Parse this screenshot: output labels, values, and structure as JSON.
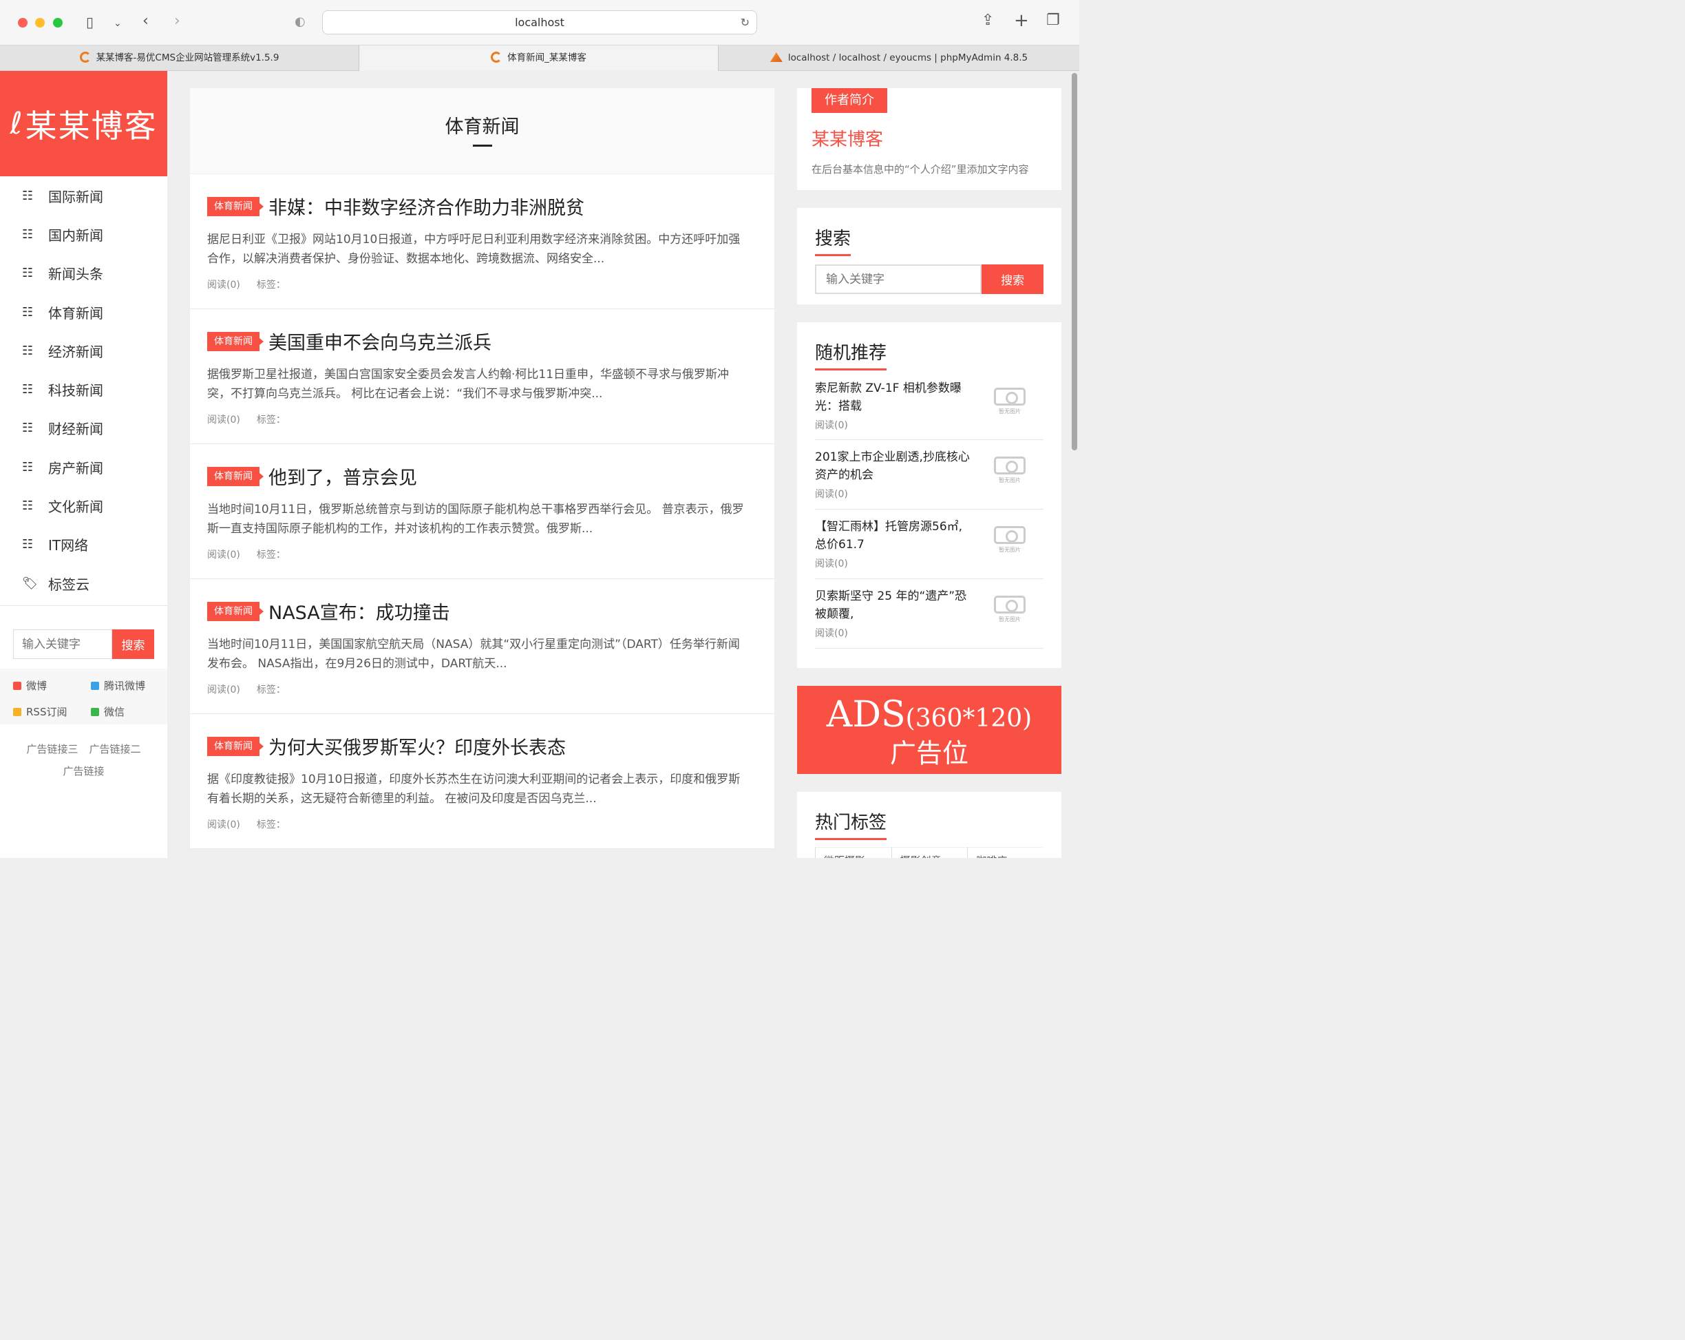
{
  "browser": {
    "url": "localhost",
    "tabs": [
      {
        "label": "某某博客-易优CMS企业网站管理系统v1.5.9"
      },
      {
        "label": "体育新闻_某某博客"
      },
      {
        "label": "localhost / localhost / eyoucms | phpMyAdmin 4.8.5"
      }
    ]
  },
  "site": {
    "logo_text": "某某博客"
  },
  "nav": [
    {
      "label": "国际新闻"
    },
    {
      "label": "国内新闻"
    },
    {
      "label": "新闻头条"
    },
    {
      "label": "体育新闻"
    },
    {
      "label": "经济新闻"
    },
    {
      "label": "科技新闻"
    },
    {
      "label": "财经新闻"
    },
    {
      "label": "房产新闻"
    },
    {
      "label": "文化新闻"
    },
    {
      "label": "IT网络"
    },
    {
      "label": "标签云"
    }
  ],
  "sidebar_search": {
    "placeholder": "输入关键字",
    "button": "搜索"
  },
  "social": [
    {
      "label": "微博",
      "color": "#f85143"
    },
    {
      "label": "腾讯微博",
      "color": "#3aa0e8"
    },
    {
      "label": "RSS订阅",
      "color": "#f5b323"
    },
    {
      "label": "微信",
      "color": "#39b54a"
    }
  ],
  "ad_links": [
    "广告链接三",
    "广告链接二",
    "广告链接"
  ],
  "category": {
    "title": "体育新闻"
  },
  "articles": [
    {
      "badge": "体育新闻",
      "title": "非媒：中非数字经济合作助力非洲脱贫",
      "summary": "据尼日利亚《卫报》网站10月10日报道，中方呼吁尼日利亚利用数字经济来消除贫困。中方还呼吁加强合作，以解决消费者保护、身份验证、数据本地化、跨境数据流、网络安全...",
      "reads": "阅读(0)",
      "tags": "标签："
    },
    {
      "badge": "体育新闻",
      "title": "美国重申不会向乌克兰派兵",
      "summary": "据俄罗斯卫星社报道，美国白宫国家安全委员会发言人约翰·柯比11日重申，华盛顿不寻求与俄罗斯冲突，不打算向乌克兰派兵。 柯比在记者会上说：“我们不寻求与俄罗斯冲突...",
      "reads": "阅读(0)",
      "tags": "标签："
    },
    {
      "badge": "体育新闻",
      "title": "他到了，普京会见",
      "summary": "当地时间10月11日，俄罗斯总统普京与到访的国际原子能机构总干事格罗西举行会见。 普京表示，俄罗斯一直支持国际原子能机构的工作，并对该机构的工作表示赞赏。俄罗斯...",
      "reads": "阅读(0)",
      "tags": "标签："
    },
    {
      "badge": "体育新闻",
      "title": "NASA宣布：成功撞击",
      "summary": "当地时间10月11日，美国国家航空航天局（NASA）就其“双小行星重定向测试”（DART）任务举行新闻发布会。 NASA指出，在9月26日的测试中，DART航天...",
      "reads": "阅读(0)",
      "tags": "标签："
    },
    {
      "badge": "体育新闻",
      "title": "为何大买俄罗斯军火？印度外长表态",
      "summary": "据《印度教徒报》10月10日报道，印度外长苏杰生在访问澳大利亚期间的记者会上表示，印度和俄罗斯有着长期的关系，这无疑符合新德里的利益。 在被问及印度是否因乌克兰...",
      "reads": "阅读(0)",
      "tags": "标签："
    }
  ],
  "author": {
    "tag": "作者简介",
    "name": "某某博客",
    "desc": "在后台基本信息中的“个人介绍”里添加文字内容"
  },
  "search_card": {
    "title": "搜索",
    "placeholder": "输入关键字",
    "button": "搜索"
  },
  "random": {
    "title": "随机推荐",
    "no_image": "暂无图片",
    "items": [
      {
        "title": "索尼新款 ZV-1F 相机参数曝光：搭载",
        "reads": "阅读(0)"
      },
      {
        "title": "201家上市企业剧透,抄底核心资产的机会",
        "reads": "阅读(0)"
      },
      {
        "title": "【智汇雨林】托管房源56㎡,总价61.7",
        "reads": "阅读(0)"
      },
      {
        "title": "贝索斯坚守 25 年的“遗产”恐被颠覆,",
        "reads": "阅读(0)"
      }
    ]
  },
  "ads": {
    "line1": "ADS",
    "line1_size": "(360*120)",
    "line2": "广告位"
  },
  "hot_tags": {
    "title": "热门标签",
    "items": [
      "微距摄影",
      "摄影创意",
      "咖啡店"
    ]
  }
}
